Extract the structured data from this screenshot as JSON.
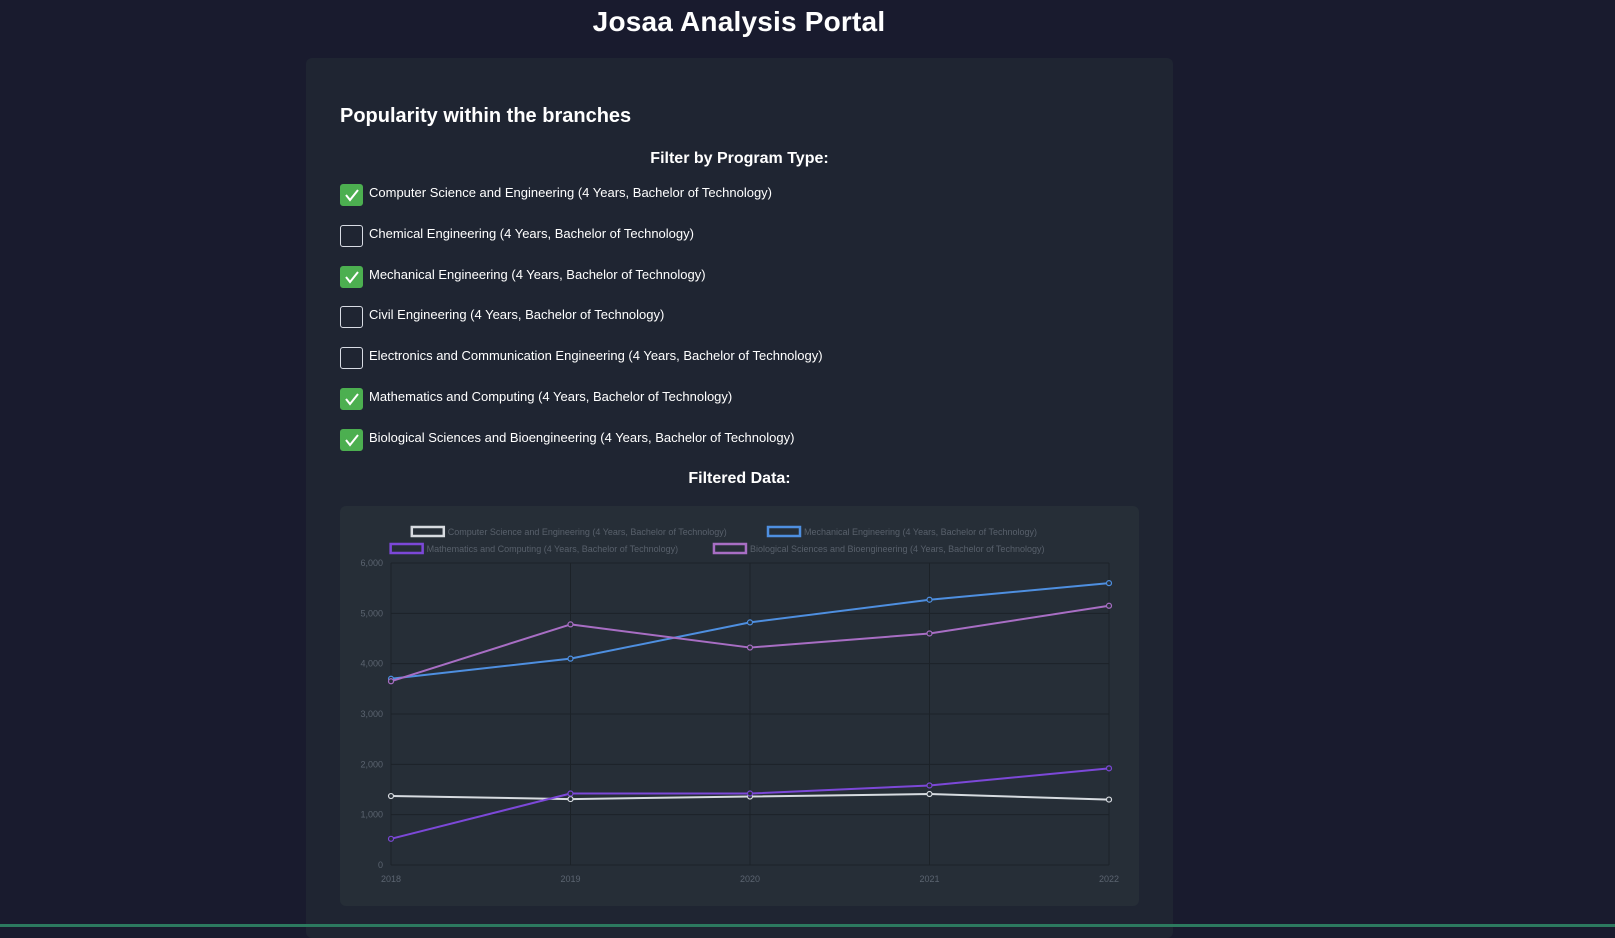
{
  "header": {
    "title": "Josaa Analysis Portal"
  },
  "section": {
    "title": "Popularity within the branches",
    "filter_heading": "Filter by Program Type:",
    "filtered_heading": "Filtered Data:"
  },
  "filters": [
    {
      "label": "Computer Science and Engineering (4 Years, Bachelor of Technology)",
      "checked": true
    },
    {
      "label": "Chemical Engineering (4 Years, Bachelor of Technology)",
      "checked": false
    },
    {
      "label": "Mechanical Engineering (4 Years, Bachelor of Technology)",
      "checked": true
    },
    {
      "label": "Civil Engineering (4 Years, Bachelor of Technology)",
      "checked": false
    },
    {
      "label": "Electronics and Communication Engineering (4 Years, Bachelor of Technology)",
      "checked": false
    },
    {
      "label": "Mathematics and Computing (4 Years, Bachelor of Technology)",
      "checked": true
    },
    {
      "label": "Biological Sciences and Bioengineering (4 Years, Bachelor of Technology)",
      "checked": true
    }
  ],
  "colors": {
    "checkbox_checked": "#4caf50",
    "panel_bg": "#262e37",
    "axis_text": "#5b6470",
    "legend_text": "#58606b",
    "grid": "#1c2228"
  },
  "chart_data": {
    "type": "line",
    "x": [
      "2018",
      "2019",
      "2020",
      "2021",
      "2022"
    ],
    "ylim": [
      0,
      6000
    ],
    "yticks": [
      0,
      1000,
      2000,
      3000,
      4000,
      5000,
      6000
    ],
    "ytick_labels": [
      "0",
      "1,000",
      "2,000",
      "3,000",
      "4,000",
      "5,000",
      "6,000"
    ],
    "grid": true,
    "legend_position": "top",
    "series": [
      {
        "name": "Computer Science and Engineering (4 Years, Bachelor of Technology)",
        "color": "#d7dbe0",
        "values": [
          1370,
          1310,
          1360,
          1410,
          1300
        ]
      },
      {
        "name": "Mechanical Engineering (4 Years, Bachelor of Technology)",
        "color": "#4e8fe0",
        "values": [
          3700,
          4100,
          4820,
          5270,
          5600
        ]
      },
      {
        "name": "Mathematics and Computing (4 Years, Bachelor of Technology)",
        "color": "#7c48d8",
        "values": [
          520,
          1420,
          1420,
          1580,
          1920
        ]
      },
      {
        "name": "Biological Sciences and Bioengineering (4 Years, Bachelor of Technology)",
        "color": "#a86ec4",
        "values": [
          3650,
          4780,
          4320,
          4600,
          5150
        ]
      }
    ]
  }
}
